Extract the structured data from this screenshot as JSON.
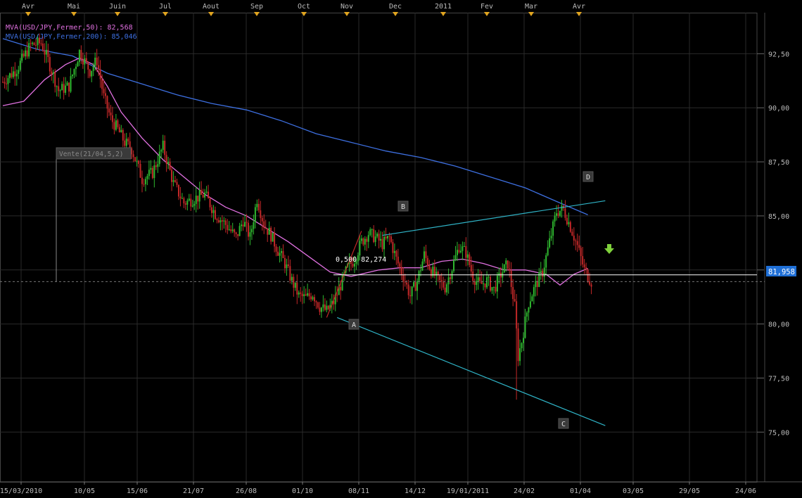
{
  "chart_data": {
    "type": "candlestick",
    "instrument": "USD/JPY",
    "legend": [
      {
        "label": "MVA(USD/JPY,Fermer,50): 82,568",
        "color": "#e070e0"
      },
      {
        "label": "MVA(USD/JPY,Fermer,200): 85,046",
        "color": "#3d6fe0"
      }
    ],
    "top_months": [
      "Avr",
      "Mai",
      "Juin",
      "Jul",
      "Aout",
      "Sep",
      "Oct",
      "Nov",
      "Dec",
      "2011",
      "Fev",
      "Mar",
      "Avr"
    ],
    "bottom_dates": [
      "15/03/2010",
      "10/05",
      "15/06",
      "21/07",
      "26/08",
      "01/10",
      "08/11",
      "14/12",
      "19/01/2011",
      "24/02",
      "01/04",
      "03/05",
      "29/05",
      "24/06"
    ],
    "y_ticks": [
      "92,50",
      "90,00",
      "87,50",
      "85,00",
      "82,50",
      "80,00",
      "77,50",
      "75,00"
    ],
    "y_tick_values": [
      92.5,
      90.0,
      87.5,
      85.0,
      82.5,
      80.0,
      77.5,
      75.0
    ],
    "ylim": [
      72.7,
      94.4
    ],
    "last_price": "81,958",
    "last_price_value": 81.958,
    "annotations": {
      "vente": "Vente(21/04,5,2)",
      "fib_level": "0,500 82,274",
      "fib_value": 82.274,
      "points": [
        "A",
        "B",
        "C",
        "D"
      ]
    },
    "colors": {
      "up": "#2fb82f",
      "down": "#c22828",
      "ma50": "#e070e0",
      "ma200": "#3d6fe0",
      "channel": "#2fb3c6",
      "fib": "#ffffff",
      "arrow": "#7fd13b"
    },
    "price_path": [
      [
        0,
        91.2
      ],
      [
        4,
        91.8
      ],
      [
        8,
        92.9
      ],
      [
        11,
        93.0
      ],
      [
        13,
        92.2
      ],
      [
        16,
        90.8
      ],
      [
        19,
        91.0
      ],
      [
        22,
        92.6
      ],
      [
        25,
        91.7
      ],
      [
        27,
        92.2
      ],
      [
        29,
        90.5
      ],
      [
        31,
        89.5
      ],
      [
        33,
        89.0
      ],
      [
        35,
        88.4
      ],
      [
        37,
        88.1
      ],
      [
        40,
        86.7
      ],
      [
        43,
        87.0
      ],
      [
        46,
        88.2
      ],
      [
        49,
        86.5
      ],
      [
        52,
        85.6
      ],
      [
        55,
        85.8
      ],
      [
        58,
        86.0
      ],
      [
        61,
        85.1
      ],
      [
        64,
        84.6
      ],
      [
        67,
        84.0
      ],
      [
        69,
        84.8
      ],
      [
        71,
        84.0
      ],
      [
        73,
        85.8
      ],
      [
        75,
        84.6
      ],
      [
        77,
        84.1
      ],
      [
        79,
        83.4
      ],
      [
        81,
        82.8
      ],
      [
        83,
        82.0
      ],
      [
        85,
        81.3
      ],
      [
        87,
        81.2
      ],
      [
        89,
        81.4
      ],
      [
        91,
        80.8
      ],
      [
        93,
        80.6
      ],
      [
        95,
        81.0
      ],
      [
        97,
        81.8
      ],
      [
        99,
        82.6
      ],
      [
        101,
        83.0
      ],
      [
        103,
        83.8
      ],
      [
        105,
        84.2
      ],
      [
        107,
        84.0
      ],
      [
        109,
        83.7
      ],
      [
        111,
        84.0
      ],
      [
        113,
        83.0
      ],
      [
        115,
        82.2
      ],
      [
        117,
        81.3
      ],
      [
        119,
        82.0
      ],
      [
        121,
        83.2
      ],
      [
        123,
        82.5
      ],
      [
        125,
        82.0
      ],
      [
        127,
        81.7
      ],
      [
        129,
        82.6
      ],
      [
        131,
        83.6
      ],
      [
        133,
        83.3
      ],
      [
        135,
        82.2
      ],
      [
        137,
        81.8
      ],
      [
        139,
        82.0
      ],
      [
        141,
        81.6
      ],
      [
        143,
        82.3
      ],
      [
        145,
        82.8
      ],
      [
        147,
        80.8
      ],
      [
        148,
        78.5
      ],
      [
        149,
        79.2
      ],
      [
        151,
        81.0
      ],
      [
        153,
        81.8
      ],
      [
        155,
        82.4
      ],
      [
        157,
        83.8
      ],
      [
        159,
        85.2
      ],
      [
        161,
        85.3
      ],
      [
        163,
        84.5
      ],
      [
        165,
        83.6
      ],
      [
        167,
        82.5
      ],
      [
        169,
        81.96
      ]
    ],
    "ma50_path": [
      [
        0,
        90.1
      ],
      [
        6,
        90.3
      ],
      [
        12,
        91.3
      ],
      [
        18,
        92.0
      ],
      [
        22,
        92.3
      ],
      [
        26,
        92.0
      ],
      [
        30,
        91.0
      ],
      [
        34,
        89.8
      ],
      [
        40,
        88.6
      ],
      [
        46,
        87.6
      ],
      [
        52,
        86.8
      ],
      [
        58,
        86.0
      ],
      [
        64,
        85.4
      ],
      [
        70,
        85.0
      ],
      [
        76,
        84.4
      ],
      [
        82,
        83.8
      ],
      [
        88,
        83.1
      ],
      [
        94,
        82.4
      ],
      [
        100,
        82.2
      ],
      [
        108,
        82.5
      ],
      [
        114,
        82.6
      ],
      [
        120,
        82.6
      ],
      [
        126,
        82.9
      ],
      [
        132,
        83.0
      ],
      [
        138,
        82.8
      ],
      [
        144,
        82.5
      ],
      [
        150,
        82.5
      ],
      [
        156,
        82.3
      ],
      [
        160,
        81.8
      ],
      [
        164,
        82.3
      ],
      [
        168,
        82.57
      ]
    ],
    "ma200_path": [
      [
        0,
        93.2
      ],
      [
        10,
        92.7
      ],
      [
        20,
        92.4
      ],
      [
        30,
        91.6
      ],
      [
        40,
        91.1
      ],
      [
        50,
        90.6
      ],
      [
        60,
        90.2
      ],
      [
        70,
        89.9
      ],
      [
        80,
        89.4
      ],
      [
        90,
        88.8
      ],
      [
        100,
        88.4
      ],
      [
        110,
        88.0
      ],
      [
        120,
        87.7
      ],
      [
        130,
        87.3
      ],
      [
        140,
        86.8
      ],
      [
        150,
        86.3
      ],
      [
        160,
        85.6
      ],
      [
        168,
        85.05
      ]
    ],
    "channel_upper": [
      [
        109,
        84.1
      ],
      [
        173,
        85.7
      ]
    ],
    "channel_lower": [
      [
        96,
        80.3
      ],
      [
        173,
        75.3
      ]
    ],
    "red_trend": [
      [
        93,
        80.3
      ],
      [
        103,
        84.3
      ]
    ],
    "x_range": [
      0,
      210
    ]
  }
}
